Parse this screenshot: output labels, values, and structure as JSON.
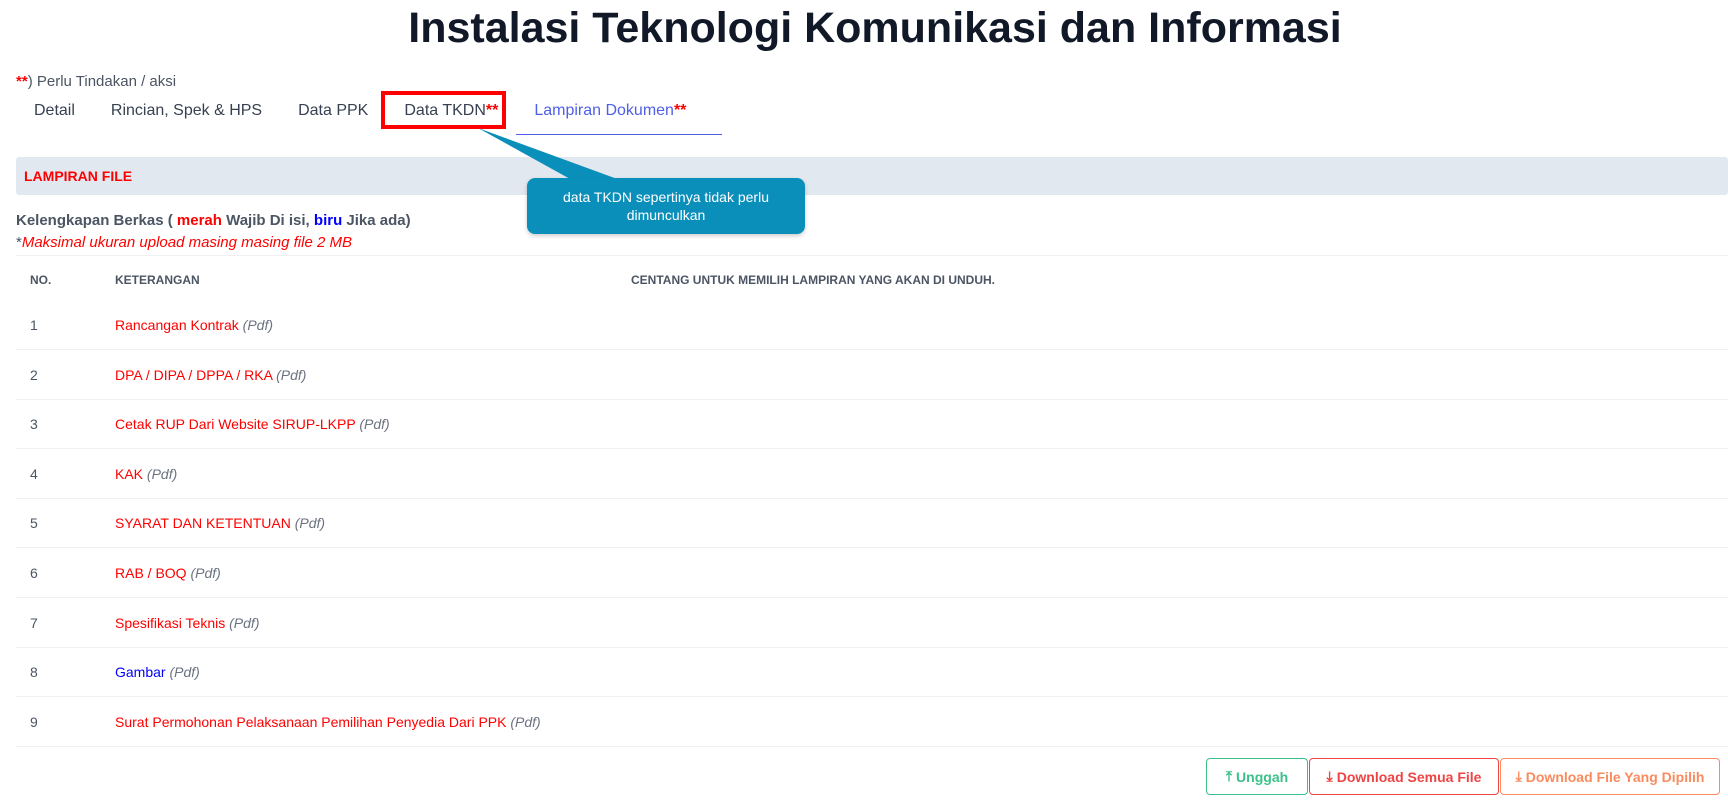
{
  "title": "Instalasi Teknologi Komunikasi dan Informasi",
  "note": {
    "marker": "**",
    "text": ") Perlu Tindakan / aksi"
  },
  "tabs": [
    {
      "label": "Detail"
    },
    {
      "label": "Rincian, Spek & HPS"
    },
    {
      "label": "Data PPK"
    },
    {
      "label": "Data TKDN",
      "marker": "**"
    },
    {
      "label": "Lampiran Dokumen",
      "marker": "**"
    }
  ],
  "section_title": "LAMPIRAN FILE",
  "tooltip": "data TKDN sepertinya tidak perlu dimunculkan",
  "kelengkapan": {
    "a": "Kelengkapan Berkas ( ",
    "merah": "merah",
    "b": " Wajib Di isi, ",
    "biru": "biru",
    "c": " Jika ada)"
  },
  "max_note": {
    "star": "*",
    "text": "Maksimal ukuran upload masing masing file 2 MB"
  },
  "table": {
    "headers": [
      "NO.",
      "KETERANGAN",
      "CENTANG UNTUK MEMILIH LAMPIRAN YANG AKAN DI UNDUH."
    ],
    "rows": [
      {
        "no": "1",
        "label": "Rancangan Kontrak",
        "type": "(Pdf)",
        "color": "#ff0000"
      },
      {
        "no": "2",
        "label": "DPA / DIPA / DPPA / RKA",
        "type": "(Pdf)",
        "color": "#ff0000"
      },
      {
        "no": "3",
        "label": "Cetak RUP Dari Website SIRUP-LKPP",
        "type": "(Pdf)",
        "color": "#ff0000"
      },
      {
        "no": "4",
        "label": "KAK",
        "type": "(Pdf)",
        "color": "#ff0000"
      },
      {
        "no": "5",
        "label": "SYARAT DAN KETENTUAN",
        "type": "(Pdf)",
        "color": "#ff0000"
      },
      {
        "no": "6",
        "label": "RAB / BOQ",
        "type": "(Pdf)",
        "color": "#ff0000"
      },
      {
        "no": "7",
        "label": "Spesifikasi Teknis",
        "type": "(Pdf)",
        "color": "#ff0000"
      },
      {
        "no": "8",
        "label": "Gambar",
        "type": "(Pdf)",
        "color": "#0000ff"
      },
      {
        "no": "9",
        "label": "Surat Permohonan Pelaksanaan Pemilihan Penyedia Dari PPK",
        "type": "(Pdf)",
        "color": "#ff0000"
      }
    ]
  },
  "buttons": {
    "upload": "Unggah",
    "download_all": "Download Semua File",
    "download_selected": "Download File Yang Dipilih"
  }
}
